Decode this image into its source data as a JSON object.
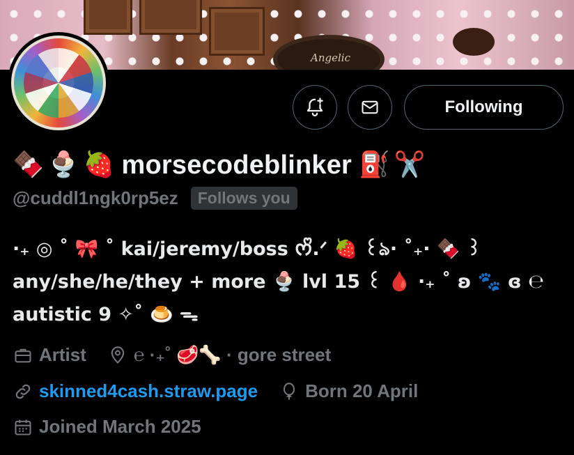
{
  "banner": {
    "cake_label": "Angelic"
  },
  "actions": {
    "notify_icon": "bell-plus-icon",
    "message_icon": "envelope-icon",
    "following_label": "Following"
  },
  "profile": {
    "name_prefix_emojis": [
      "🍫",
      "🍨",
      "🍓"
    ],
    "display_name": "morsecodeblinker",
    "name_suffix_emojis": [
      "⛽",
      "✂️"
    ],
    "handle": "@cuddl1ngk0rp5ez",
    "follows_you": "Follows you"
  },
  "bio": {
    "line1": "·₊ ◎ ˚ 🎀 ˚ kai/jeremy/boss ᰔᩚ.ᐟ 🍓 ꒰ঌ· ˚₊· 🍫 ꒱",
    "line2": "any/she/he/they + more 🍨 lvl 15 ꒰ 🩸 ·₊ ˚ ʚ 🐾 ɞ ℮",
    "line3": "autistic 9 ✧˚ 🍮 ᯓ"
  },
  "meta": {
    "category": "Artist",
    "location_text": "℮ ·₊˚ 🥩🦴 · gore street",
    "website": "skinned4cash.straw.page",
    "birthday": "Born 20 April",
    "joined": "Joined March 2025"
  },
  "colors": {
    "background": "#000000",
    "text": "#e7e9ea",
    "muted": "#71767b",
    "link": "#1d9bf0",
    "border": "#536471"
  }
}
